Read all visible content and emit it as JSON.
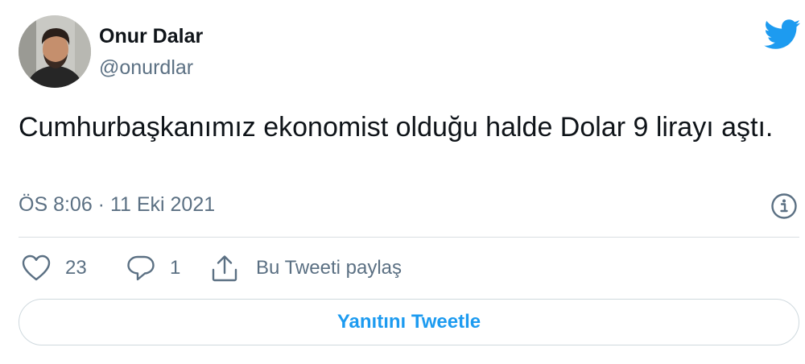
{
  "author": {
    "display_name": "Onur Dalar",
    "handle": "@onurdlar"
  },
  "tweet": {
    "text": "Cumhurbaşkanımız ekonomist olduğu halde Dolar 9 lirayı aştı.",
    "timestamp": "ÖS 8:06 · 11 Eki 2021"
  },
  "actions": {
    "likes": "23",
    "replies": "1",
    "share_label": "Bu Tweeti paylaş"
  },
  "reply_button": {
    "label": "Yanıtını Tweetle"
  },
  "icons": {
    "brand": "twitter-bird-icon",
    "info": "info-icon",
    "like": "heart-icon",
    "reply": "speech-bubble-icon",
    "share": "share-icon"
  },
  "colors": {
    "brand_blue": "#1d9bf0",
    "secondary_text": "#5b7083",
    "primary_text": "#0f1419",
    "border": "#cfd9de"
  }
}
